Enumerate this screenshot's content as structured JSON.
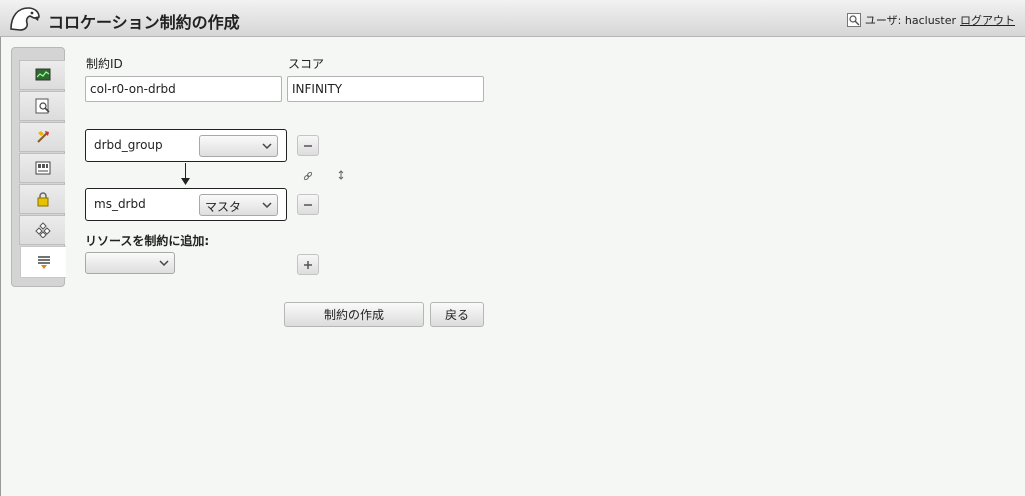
{
  "header": {
    "title": "コロケーション制約の作成",
    "user_label": "ユーザ: hacluster",
    "logout": "ログアウト"
  },
  "sidebar": {
    "items": [
      {
        "icon": "monitor-icon"
      },
      {
        "icon": "inspect-icon"
      },
      {
        "icon": "tools-icon"
      },
      {
        "icon": "nodes-icon"
      },
      {
        "icon": "lock-icon"
      },
      {
        "icon": "resources-icon"
      },
      {
        "icon": "constraints-icon",
        "active": true
      }
    ]
  },
  "form": {
    "id_label": "制約ID",
    "id_value": "col-r0-on-drbd",
    "score_label": "スコア",
    "score_value": "INFINITY",
    "resources": [
      {
        "name": "drbd_group",
        "role": ""
      },
      {
        "name": "ms_drbd",
        "role": "マスタ"
      }
    ],
    "add_label": "リソースを制約に追加:",
    "add_select_value": ""
  },
  "buttons": {
    "create": "制約の作成",
    "back": "戻る"
  }
}
